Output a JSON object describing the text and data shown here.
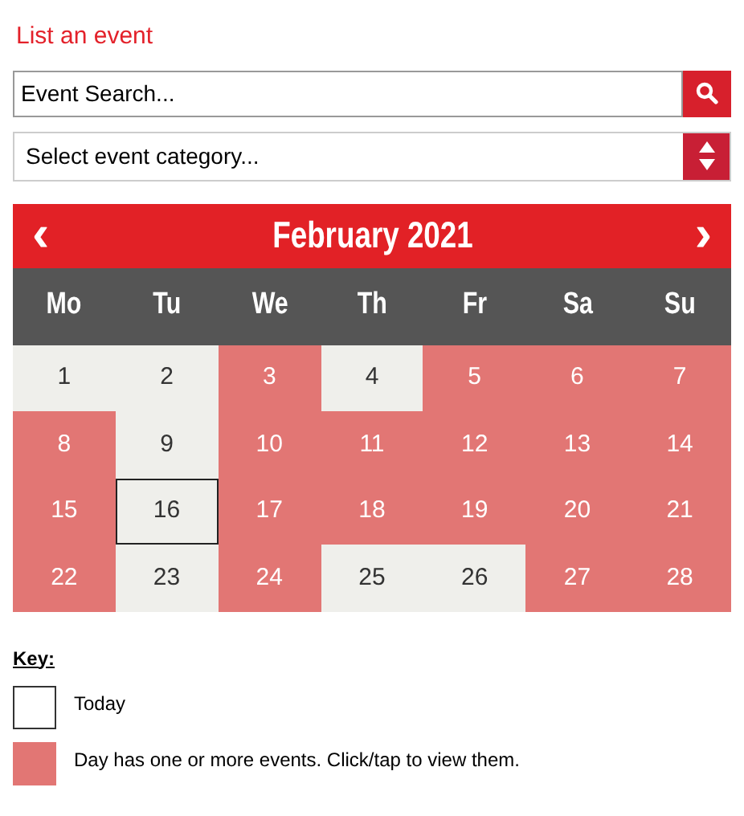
{
  "link": "List an event",
  "search": {
    "placeholder": "Event Search..."
  },
  "category_select": {
    "value": "Select event category..."
  },
  "calendar": {
    "month": "February 2021",
    "prev": "‹",
    "next": "›",
    "weekdays": [
      "Mo",
      "Tu",
      "We",
      "Th",
      "Fr",
      "Sa",
      "Su"
    ],
    "days": [
      {
        "label": "1",
        "has_events": false,
        "today": false
      },
      {
        "label": "2",
        "has_events": false,
        "today": false
      },
      {
        "label": "3",
        "has_events": true,
        "today": false
      },
      {
        "label": "4",
        "has_events": false,
        "today": false
      },
      {
        "label": "5",
        "has_events": true,
        "today": false
      },
      {
        "label": "6",
        "has_events": true,
        "today": false
      },
      {
        "label": "7",
        "has_events": true,
        "today": false
      },
      {
        "label": "8",
        "has_events": true,
        "today": false
      },
      {
        "label": "9",
        "has_events": false,
        "today": false
      },
      {
        "label": "10",
        "has_events": true,
        "today": false
      },
      {
        "label": "11",
        "has_events": true,
        "today": false
      },
      {
        "label": "12",
        "has_events": true,
        "today": false
      },
      {
        "label": "13",
        "has_events": true,
        "today": false
      },
      {
        "label": "14",
        "has_events": true,
        "today": false
      },
      {
        "label": "15",
        "has_events": true,
        "today": false
      },
      {
        "label": "16",
        "has_events": false,
        "today": true
      },
      {
        "label": "17",
        "has_events": true,
        "today": false
      },
      {
        "label": "18",
        "has_events": true,
        "today": false
      },
      {
        "label": "19",
        "has_events": true,
        "today": false
      },
      {
        "label": "20",
        "has_events": true,
        "today": false
      },
      {
        "label": "21",
        "has_events": true,
        "today": false
      },
      {
        "label": "22",
        "has_events": true,
        "today": false
      },
      {
        "label": "23",
        "has_events": false,
        "today": false
      },
      {
        "label": "24",
        "has_events": true,
        "today": false
      },
      {
        "label": "25",
        "has_events": false,
        "today": false
      },
      {
        "label": "26",
        "has_events": false,
        "today": false
      },
      {
        "label": "27",
        "has_events": true,
        "today": false
      },
      {
        "label": "28",
        "has_events": true,
        "today": false
      }
    ]
  },
  "key": {
    "title": "Key:",
    "items": [
      {
        "kind": "today",
        "label": "Today"
      },
      {
        "kind": "events",
        "label": "Day has one or more events. Click/tap to view them."
      }
    ]
  }
}
